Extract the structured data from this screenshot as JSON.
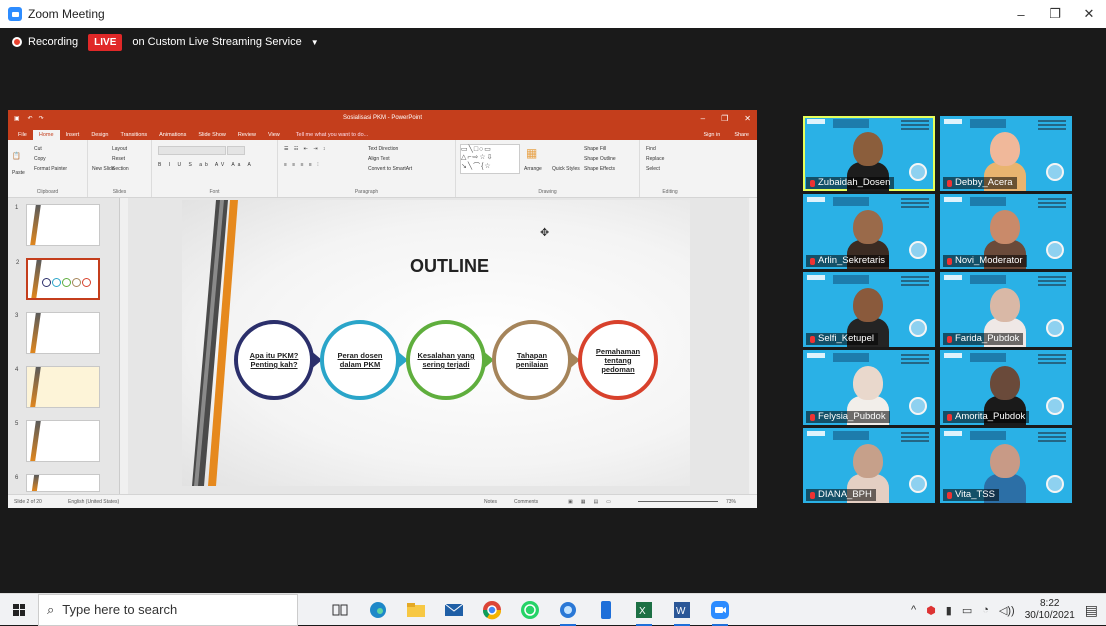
{
  "window": {
    "title": "Zoom Meeting",
    "minimize": "–",
    "restore": "❐",
    "close": "✕"
  },
  "recording": {
    "label": "Recording",
    "live_badge": "LIVE",
    "stream": "on Custom Live Streaming Service"
  },
  "powerpoint": {
    "filename": "Sosialisasi PKM - PowerPoint",
    "tabs": [
      "File",
      "Home",
      "Insert",
      "Design",
      "Transitions",
      "Animations",
      "Slide Show",
      "Review",
      "View"
    ],
    "active_tab": "Home",
    "tell_me": "Tell me what you want to do...",
    "sign_in": "Sign in",
    "share": "Share",
    "ribbon_groups": [
      "Clipboard",
      "Slides",
      "Font",
      "Paragraph",
      "Drawing",
      "Editing"
    ],
    "ribbon_items": {
      "cut": "Cut",
      "copy": "Copy",
      "format_painter": "Format Painter",
      "paste": "Paste",
      "layout": "Layout",
      "reset": "Reset",
      "section": "Section",
      "new_slide": "New Slide",
      "text_direction": "Text Direction",
      "align_text": "Align Text",
      "convert_smartart": "Convert to SmartArt",
      "arrange": "Arrange",
      "quick_styles": "Quick Styles",
      "shape_fill": "Shape Fill",
      "shape_outline": "Shape Outline",
      "shape_effects": "Shape Effects",
      "find": "Find",
      "replace": "Replace",
      "select": "Select"
    },
    "thumbnail_numbers": [
      "1",
      "2",
      "3",
      "4",
      "5",
      "6"
    ],
    "status": {
      "slide": "Slide 2 of 20",
      "language": "English (United States)",
      "notes": "Notes",
      "comments": "Comments",
      "zoom": "73%"
    }
  },
  "slide": {
    "title": "OUTLINE",
    "steps": [
      {
        "text": "Apa itu PKM? Penting kah?",
        "color": "#2b2f6b"
      },
      {
        "text": "Peran dosen dalam PKM",
        "color": "#2aa5c9"
      },
      {
        "text": "Kesalahan yang sering terjadi",
        "color": "#5fae3d"
      },
      {
        "text": "Tahapan penilaian",
        "color": "#a5845a"
      },
      {
        "text": "Pemahaman tentang pedoman",
        "color": "#d8412c"
      }
    ]
  },
  "participants": [
    {
      "name": "Zubaidah_Dosen",
      "active": true,
      "skin": "#8b5e3c",
      "wear": "#1d1d1d"
    },
    {
      "name": "Debby_Acera",
      "active": false,
      "skin": "#f0b89a",
      "wear": "#e9b46f"
    },
    {
      "name": "Arlin_Sekretaris",
      "active": false,
      "skin": "#9a6a4a",
      "wear": "#3b2b22"
    },
    {
      "name": "Novi_Moderator",
      "active": false,
      "skin": "#c98a6a",
      "wear": "#6a4a3a"
    },
    {
      "name": "Selfi_Ketupel",
      "active": false,
      "skin": "#8a5a3c",
      "wear": "#242424"
    },
    {
      "name": "Farida_Pubdok",
      "active": false,
      "skin": "#d9b8a6",
      "wear": "#efe8e6"
    },
    {
      "name": "Felysia_Pubdok",
      "active": false,
      "skin": "#e9d8cc",
      "wear": "#f2eeea"
    },
    {
      "name": "Amorita_Pubdok",
      "active": false,
      "skin": "#6a4a3a",
      "wear": "#1a1a1a"
    },
    {
      "name": "DIANA_BPH",
      "active": false,
      "skin": "#c6a08a",
      "wear": "#e4cfc3"
    },
    {
      "name": "Vita_TSS",
      "active": false,
      "skin": "#c89a86",
      "wear": "#2c6fa6"
    }
  ],
  "taskbar": {
    "search_placeholder": "Type here to search",
    "apps": [
      "task-view",
      "edge",
      "file-explorer",
      "mail",
      "chrome",
      "whatsapp",
      "edge-dev",
      "phone",
      "excel",
      "word",
      "zoom"
    ],
    "time": "8:22",
    "date": "30/10/2021"
  }
}
